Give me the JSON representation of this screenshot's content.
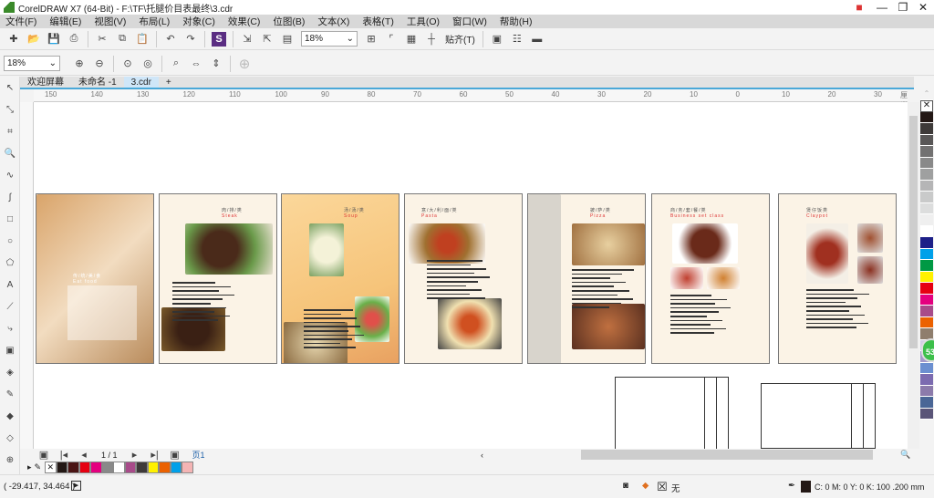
{
  "window": {
    "title": "CorelDRAW X7 (64-Bit) - F:\\TF\\托腿价目表最终\\3.cdr",
    "minimize": "—",
    "restore": "❐",
    "close": "✕"
  },
  "menu": [
    "文件(F)",
    "编辑(E)",
    "视图(V)",
    "布局(L)",
    "对象(C)",
    "效果(C)",
    "位图(B)",
    "文本(X)",
    "表格(T)",
    "工具(O)",
    "窗口(W)",
    "帮助(H)"
  ],
  "toolbar": {
    "zoom_value": "18%",
    "snap_label": "贴齐(T)",
    "icons": [
      "new-icon",
      "open-icon",
      "save-icon",
      "print-icon",
      "cut-icon",
      "copy-icon",
      "paste-icon",
      "undo-icon",
      "redo-icon",
      "search-content-icon",
      "import-icon",
      "export-icon",
      "publish-pdf-icon",
      "full-screen-icon",
      "rulers-icon",
      "grid-icon",
      "guidelines-icon",
      "welcome-icon",
      "options-icon",
      "launch-icon"
    ]
  },
  "propertybar": {
    "zoom_value": "18%",
    "icons": [
      "zoom-in-icon",
      "zoom-out-icon",
      "zoom-selected-icon",
      "zoom-all-icon",
      "zoom-page-icon",
      "zoom-width-icon",
      "zoom-height-icon",
      "add-icon"
    ]
  },
  "tabs": [
    {
      "label": "欢迎屏幕"
    },
    {
      "label": "未命名 -1"
    },
    {
      "label": "3.cdr",
      "active": true
    },
    {
      "label": "+"
    }
  ],
  "ruler": {
    "ticks": [
      "150",
      "140",
      "130",
      "120",
      "110",
      "100",
      "90",
      "80",
      "70",
      "60",
      "50",
      "40",
      "30",
      "20",
      "10",
      "0",
      "10",
      "20",
      "30"
    ],
    "unit": "厘米"
  },
  "pages": [
    {
      "title": "",
      "subtitle": ""
    },
    {
      "title": "肉/排/类",
      "subtitle": "Steak"
    },
    {
      "title": "汤/汤/类",
      "subtitle": "Soup"
    },
    {
      "title": "意/大/利/面/类",
      "subtitle": "Pasta"
    },
    {
      "title": "披/萨/类",
      "subtitle": "Pizza"
    },
    {
      "title": "商/务/套/餐/类",
      "subtitle": "Business set class"
    },
    {
      "title": "煲仔饭类",
      "subtitle": "Claypot"
    }
  ],
  "page1_heading": {
    "title": "传/统/美/食",
    "subtitle": "Eat food"
  },
  "pagenav": {
    "current": "1 / 1",
    "page_tab": "页1"
  },
  "palette": [
    "#231815",
    "#3e3a39",
    "#595757",
    "#727171",
    "#898989",
    "#9fa0a0",
    "#b5b5b6",
    "#c9caca",
    "#dcdddd",
    "#efefef",
    "#ffffff",
    "#1d2088",
    "#00a0e9",
    "#009944",
    "#fff100",
    "#e60012",
    "#e4007f",
    "#a84b8a",
    "#eb6100",
    "#8f7e6d",
    "#d4cde6",
    "#a59aca",
    "#6c8fd0",
    "#7c6bb0",
    "#8c7bab",
    "#4a6696",
    "#5a5578"
  ],
  "doc_palette": [
    "#231815",
    "#4a1414",
    "#e60012",
    "#e4007f",
    "#898989",
    "#ffffff",
    "#a84b8a",
    "#3e3a39",
    "#fff100",
    "#eb6100",
    "#00a0e9",
    "#f4b4b4"
  ],
  "notification_badge": "53",
  "status": {
    "coords": "( -29.417, 34.464 )",
    "fill_label": "无",
    "outline": "C: 0 M: 0 Y: 0 K: 100  .200 mm"
  }
}
